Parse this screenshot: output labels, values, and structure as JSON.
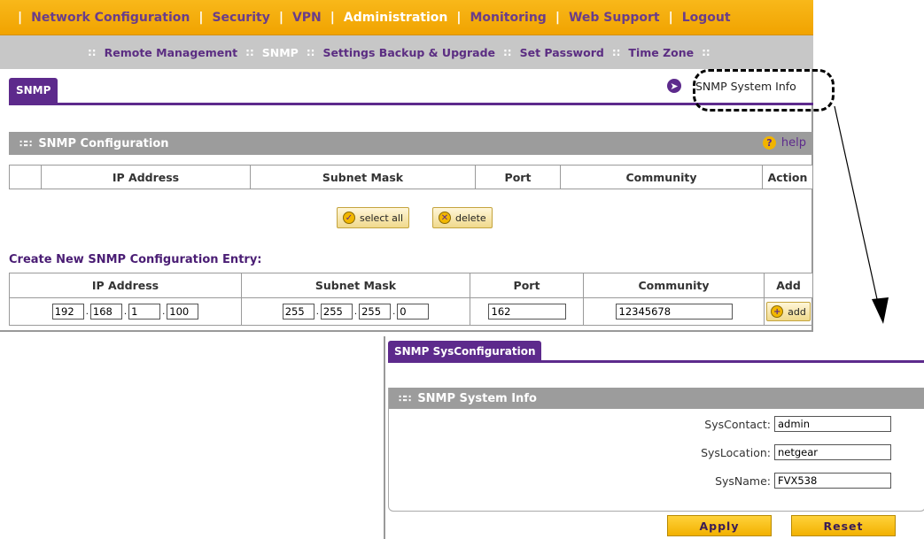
{
  "main_nav": {
    "items": [
      "Network Configuration",
      "Security",
      "VPN",
      "Administration",
      "Monitoring",
      "Web Support",
      "Logout"
    ],
    "active": "Administration"
  },
  "sub_nav": {
    "items": [
      "Remote Management",
      "SNMP",
      "Settings Backup & Upgrade",
      "Set Password",
      "Time Zone"
    ],
    "active": "SNMP"
  },
  "tab": {
    "label": "SNMP",
    "link_label": "SNMP System Info"
  },
  "snmp_config": {
    "title": "SNMP Configuration",
    "help_label": "help",
    "columns": [
      "",
      "IP Address",
      "Subnet Mask",
      "Port",
      "Community",
      "Action"
    ],
    "select_all_label": "select all",
    "delete_label": "delete"
  },
  "create_entry": {
    "title": "Create New SNMP Configuration Entry:",
    "columns": [
      "IP Address",
      "Subnet Mask",
      "Port",
      "Community",
      "Add"
    ],
    "ip": [
      "192",
      "168",
      "1",
      "100"
    ],
    "mask": [
      "255",
      "255",
      "255",
      "0"
    ],
    "port": "162",
    "community": "12345678",
    "add_label": "add"
  },
  "sys_panel": {
    "tab_label": "SNMP SysConfiguration",
    "section_title": "SNMP System Info",
    "sys_contact_label": "SysContact:",
    "sys_contact": "admin",
    "sys_location_label": "SysLocation:",
    "sys_location": "netgear",
    "sys_name_label": "SysName:",
    "sys_name": "FVX538",
    "apply_label": "Apply",
    "reset_label": "Reset"
  },
  "colors": {
    "accent_purple": "#5d2a8c",
    "nav_orange": "#f1a300",
    "section_gray": "#9c9c9c"
  }
}
